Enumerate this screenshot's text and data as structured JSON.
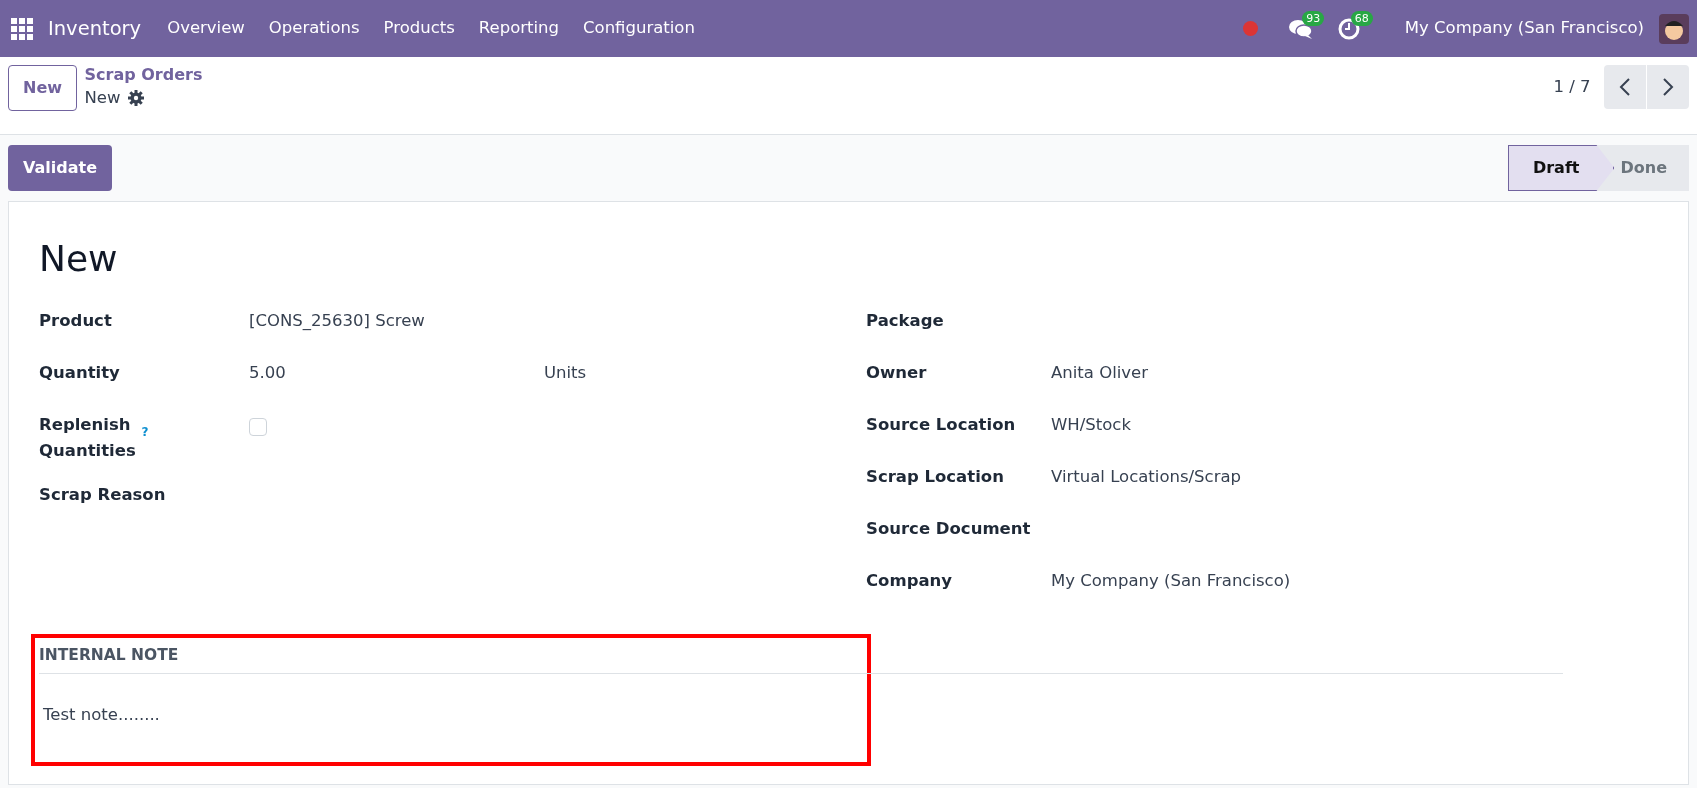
{
  "navbar": {
    "app_name": "Inventory",
    "menu": [
      "Overview",
      "Operations",
      "Products",
      "Reporting",
      "Configuration"
    ],
    "messages_badge": "93",
    "activities_badge": "68",
    "company": "My Company (San Francisco)"
  },
  "control_panel": {
    "new_button": "New",
    "breadcrumb": "Scrap Orders",
    "record": "New",
    "pager": "1 / 7"
  },
  "actions": {
    "validate": "Validate"
  },
  "status_steps": [
    {
      "label": "Draft",
      "selected": true
    },
    {
      "label": "Done",
      "selected": false
    }
  ],
  "form": {
    "title": "New",
    "left_fields": [
      {
        "label": "Product",
        "kind": "text",
        "value": "[CONS_25630] Screw"
      },
      {
        "label": "Quantity",
        "kind": "quantity",
        "value": "5.00",
        "unit": "Units"
      },
      {
        "label": "Replenish Quantities",
        "kind": "checkbox",
        "checked": false,
        "help": "?"
      },
      {
        "label": "Scrap Reason",
        "kind": "text"
      }
    ],
    "right_fields": [
      {
        "label": "Package"
      },
      {
        "label": "Owner",
        "value": "Anita Oliver"
      },
      {
        "label": "Source Location",
        "value": "WH/Stock"
      },
      {
        "label": "Scrap Location",
        "value": "Virtual Locations/Scrap"
      },
      {
        "label": "Source Document"
      },
      {
        "label": "Company",
        "value": "My Company (San Francisco)"
      }
    ],
    "note_heading": "INTERNAL NOTE",
    "note": "Test note........"
  }
}
